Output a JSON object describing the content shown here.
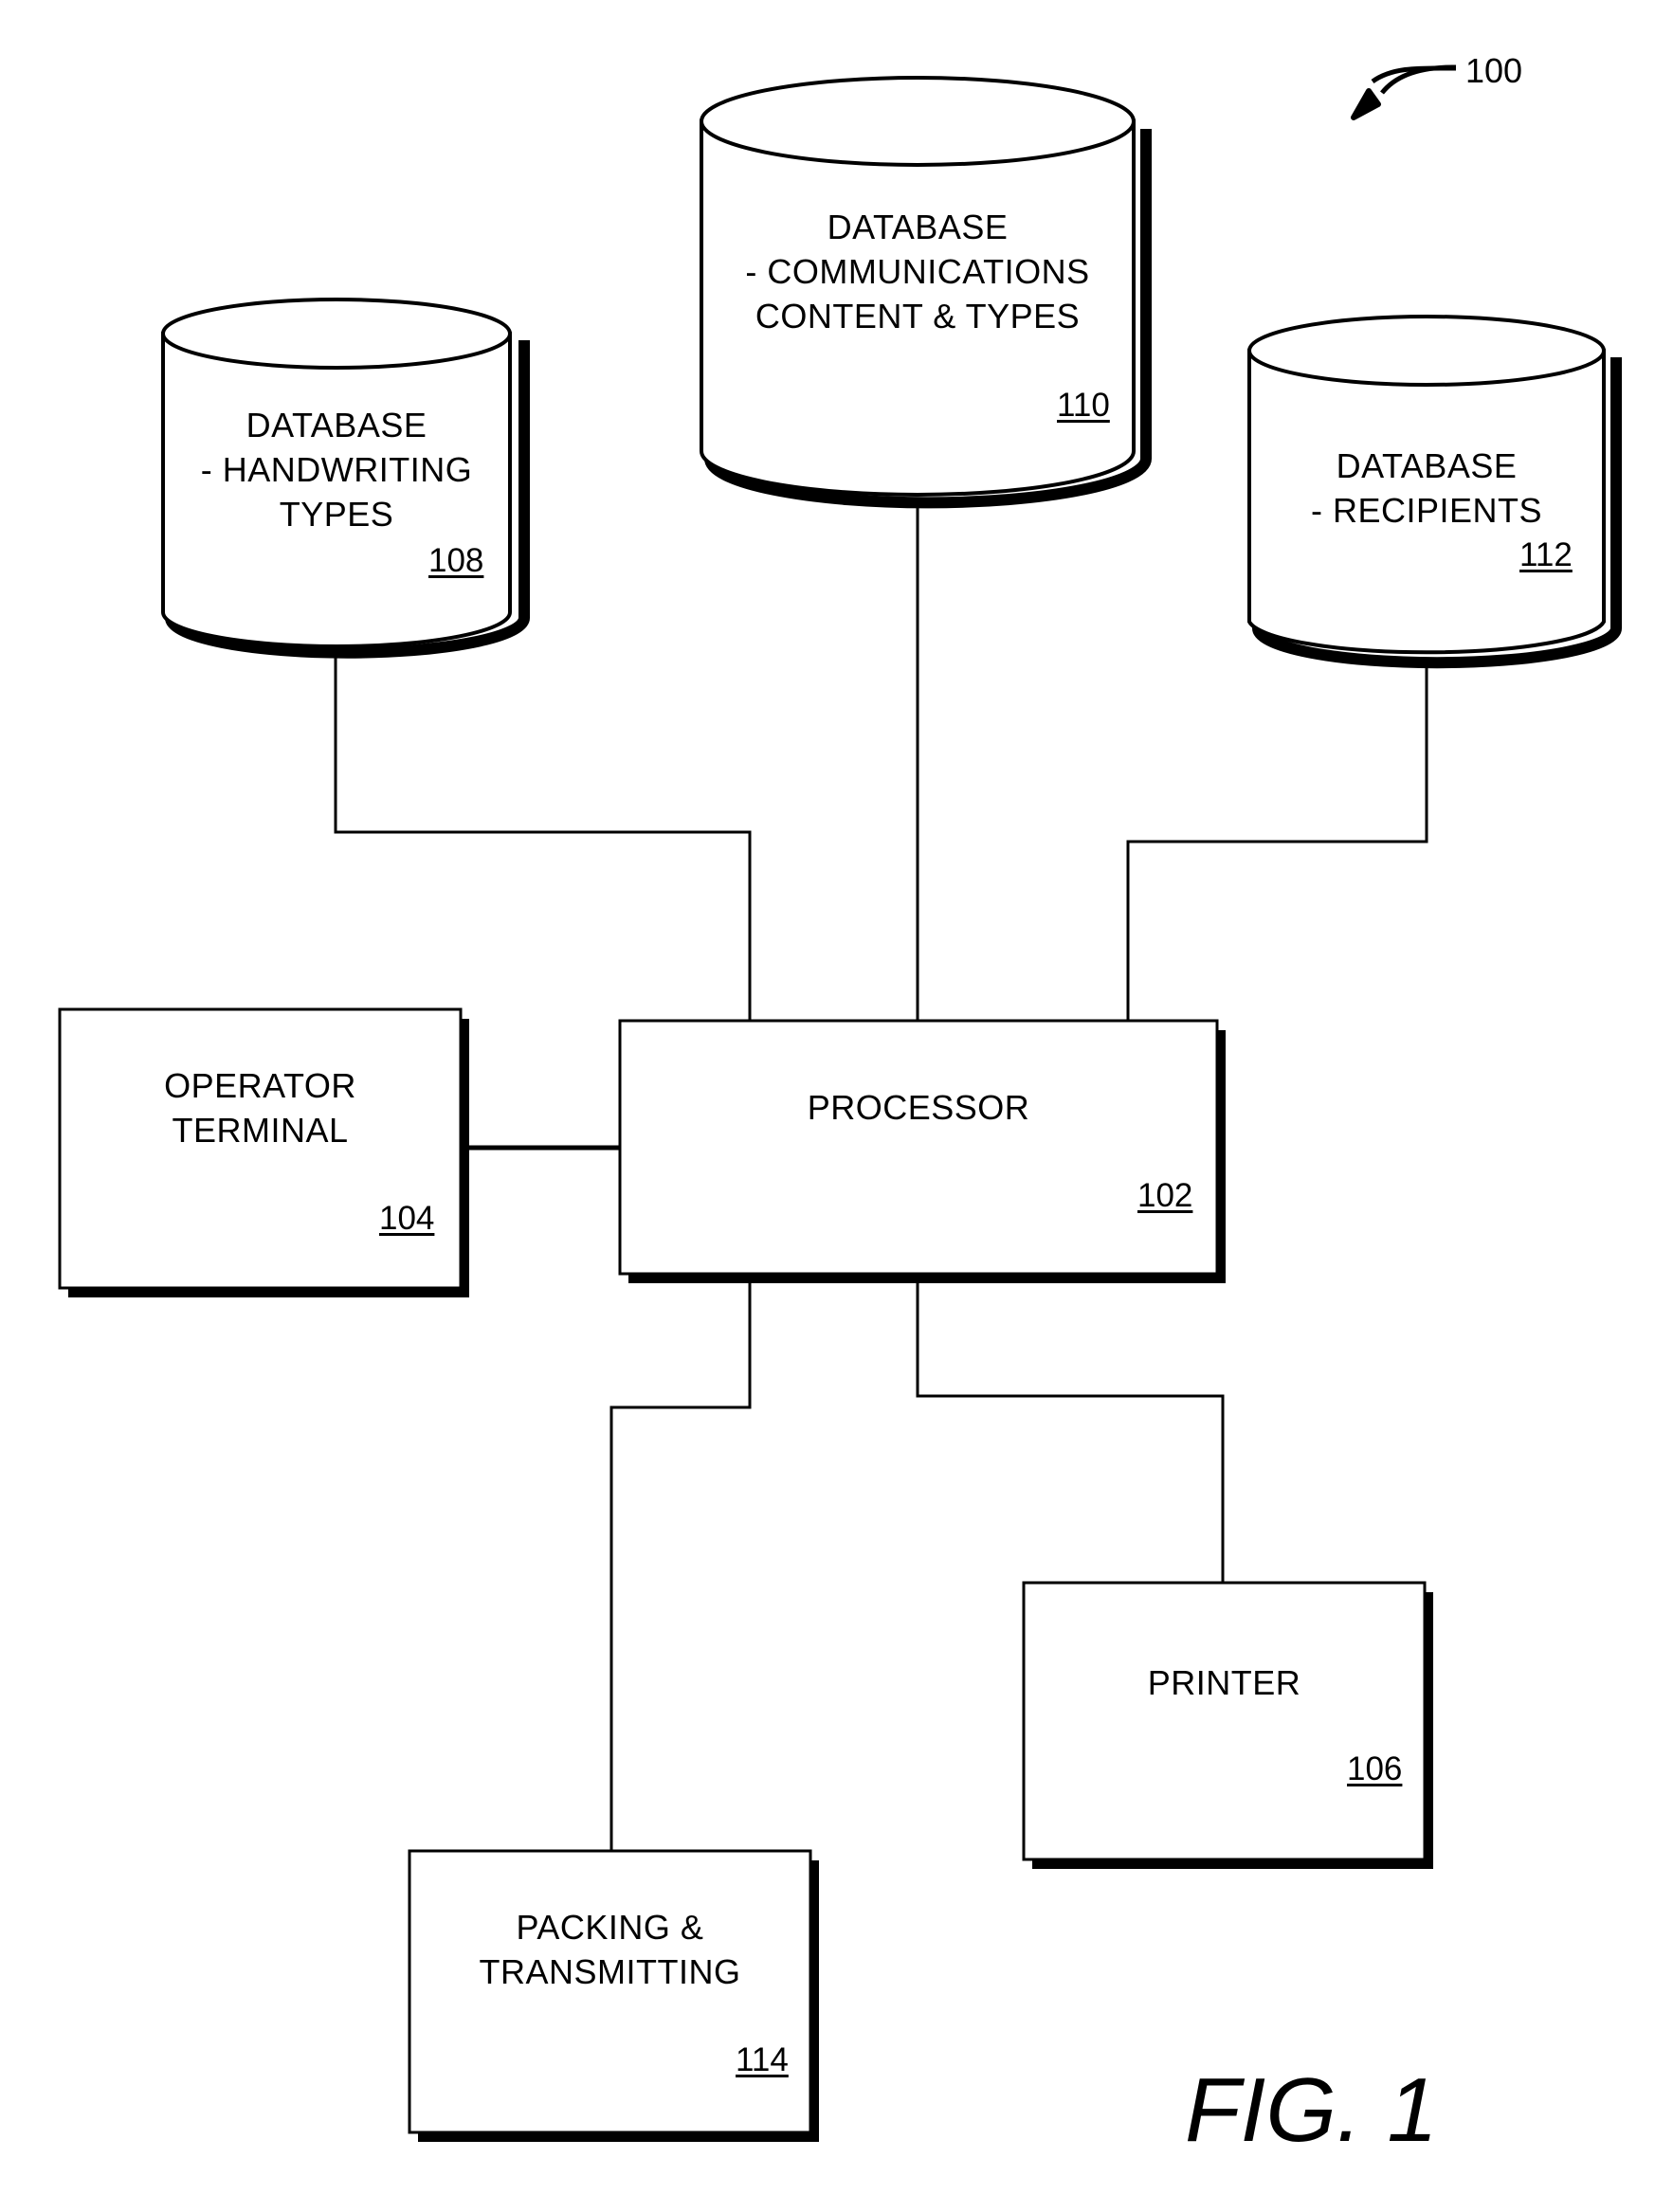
{
  "figure": {
    "label": "FIG. 1",
    "system_ref": "100"
  },
  "nodes": {
    "db_handwriting": {
      "lines": [
        "DATABASE",
        "- HANDWRITING",
        "TYPES"
      ],
      "ref": "108",
      "shape": "cylinder"
    },
    "db_communications": {
      "lines": [
        "DATABASE",
        "- COMMUNICATIONS",
        "CONTENT & TYPES"
      ],
      "ref": "110",
      "shape": "cylinder"
    },
    "db_recipients": {
      "lines": [
        "DATABASE",
        "- RECIPIENTS"
      ],
      "ref": "112",
      "shape": "cylinder"
    },
    "operator_terminal": {
      "lines": [
        "OPERATOR",
        "TERMINAL"
      ],
      "ref": "104",
      "shape": "box"
    },
    "processor": {
      "lines": [
        "PROCESSOR"
      ],
      "ref": "102",
      "shape": "box"
    },
    "printer": {
      "lines": [
        "PRINTER"
      ],
      "ref": "106",
      "shape": "box"
    },
    "packing": {
      "lines": [
        "PACKING &",
        "TRANSMITTING"
      ],
      "ref": "114",
      "shape": "box"
    }
  },
  "edges": [
    {
      "from": "db_handwriting",
      "to": "processor"
    },
    {
      "from": "db_communications",
      "to": "processor"
    },
    {
      "from": "db_recipients",
      "to": "processor"
    },
    {
      "from": "operator_terminal",
      "to": "processor"
    },
    {
      "from": "processor",
      "to": "packing"
    },
    {
      "from": "processor",
      "to": "printer"
    }
  ]
}
